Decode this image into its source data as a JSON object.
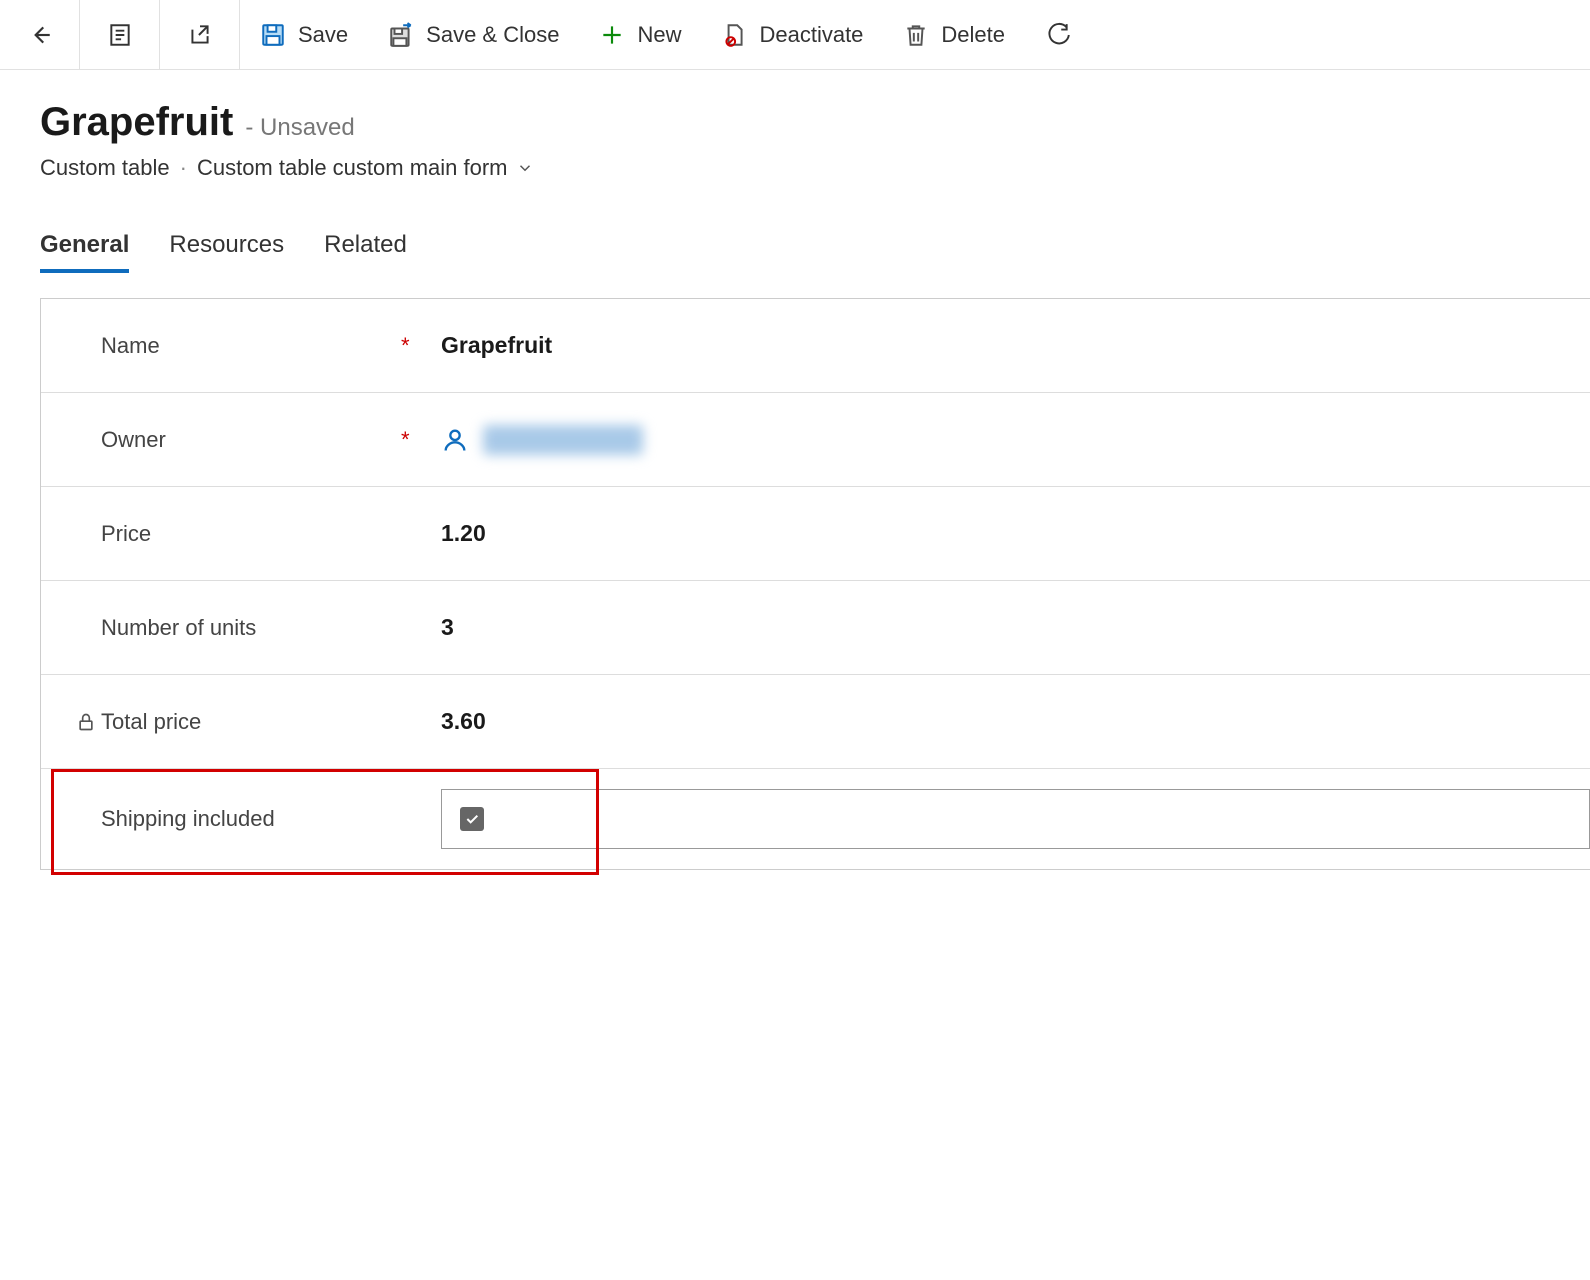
{
  "toolbar": {
    "save_label": "Save",
    "save_close_label": "Save & Close",
    "new_label": "New",
    "deactivate_label": "Deactivate",
    "delete_label": "Delete"
  },
  "header": {
    "title": "Grapefruit",
    "status": "- Unsaved",
    "table_name": "Custom table",
    "form_name": "Custom table custom main form"
  },
  "tabs": {
    "general": "General",
    "resources": "Resources",
    "related": "Related"
  },
  "fields": {
    "name": {
      "label": "Name",
      "value": "Grapefruit"
    },
    "owner": {
      "label": "Owner"
    },
    "price": {
      "label": "Price",
      "value": "1.20"
    },
    "units": {
      "label": "Number of units",
      "value": "3"
    },
    "total": {
      "label": "Total price",
      "value": "3.60"
    },
    "shipping": {
      "label": "Shipping included",
      "checked": true
    }
  }
}
